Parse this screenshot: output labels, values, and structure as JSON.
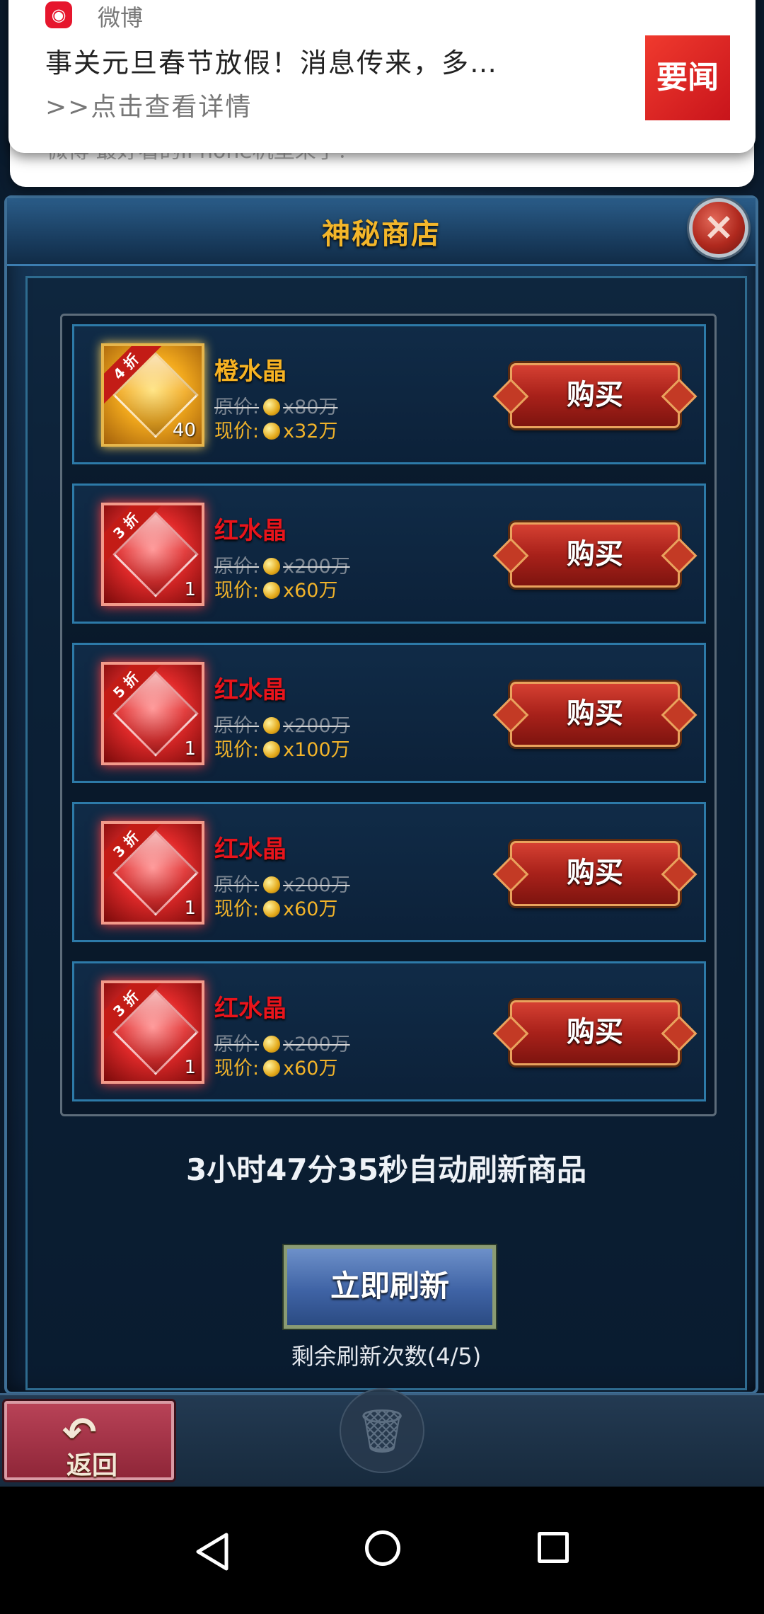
{
  "notification": {
    "app_name": "微博",
    "title": "事关元旦春节放假！消息传来，多…",
    "subtitle": ">>点击查看详情",
    "thumbnail_text": "要闻",
    "behind_text": "微博 最好看的iPhone机型来了？"
  },
  "shop": {
    "title": "神秘商店",
    "close_icon": "×",
    "items": [
      {
        "name": "橙水晶",
        "discount": "4 折",
        "count": "40",
        "orig_label": "原价:",
        "orig_price": "x80万",
        "now_label": "现价:",
        "now_price": "x32万",
        "buy_label": "购买"
      },
      {
        "name": "红水晶",
        "discount": "3 折",
        "count": "1",
        "orig_label": "原价:",
        "orig_price": "x200万",
        "now_label": "现价:",
        "now_price": "x60万",
        "buy_label": "购买"
      },
      {
        "name": "红水晶",
        "discount": "5 折",
        "count": "1",
        "orig_label": "原价:",
        "orig_price": "x200万",
        "now_label": "现价:",
        "now_price": "x100万",
        "buy_label": "购买"
      },
      {
        "name": "红水晶",
        "discount": "3 折",
        "count": "1",
        "orig_label": "原价:",
        "orig_price": "x200万",
        "now_label": "现价:",
        "now_price": "x60万",
        "buy_label": "购买"
      },
      {
        "name": "红水晶",
        "discount": "3 折",
        "count": "1",
        "orig_label": "原价:",
        "orig_price": "x200万",
        "now_label": "现价:",
        "now_price": "x60万",
        "buy_label": "购买"
      }
    ],
    "timer_text": "3小时47分35秒自动刷新商品",
    "refresh_label": "立即刷新",
    "refresh_remaining": "剩余刷新次数(4/5)"
  },
  "bottom": {
    "back_label": "返回",
    "back_icon": "↶",
    "trash_icon": "🗑"
  },
  "colors": {
    "accent_gold": "#f3b62a",
    "orange_crystal": "#f7b323",
    "red_crystal": "#e8141b"
  }
}
